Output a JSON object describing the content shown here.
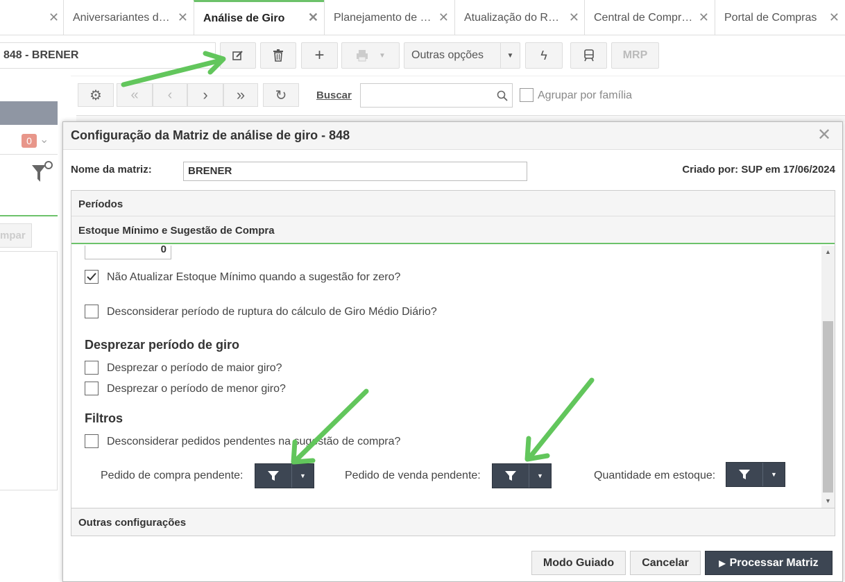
{
  "tabs": [
    {
      "label": "Aniversariantes d…"
    },
    {
      "label": "Análise de Giro"
    },
    {
      "label": "Planejamento de …"
    },
    {
      "label": "Atualização do R…"
    },
    {
      "label": "Central de Compr…"
    },
    {
      "label": "Portal de Compras"
    }
  ],
  "toolbar": {
    "selected_record": "848 - BRENER",
    "other_options": "Outras opções",
    "mrp": "MRP"
  },
  "nav": {
    "search_link": "Buscar",
    "group_by_family": "Agrupar por família"
  },
  "left_panel": {
    "badge_count": "0",
    "clear_button": "mpar"
  },
  "dialog": {
    "title": "Configuração da Matriz de análise de giro - 848",
    "matrix_name_label": "Nome da matriz:",
    "matrix_name_value": "BRENER",
    "created_by": "Criado por: SUP em 17/06/2024",
    "sections": {
      "periods": "Períodos",
      "stock": "Estoque Mínimo e Sugestão de Compra",
      "other": "Outras configurações"
    },
    "stock_input_value": "0",
    "options": {
      "no_update_min_stock": "Não Atualizar Estoque Mínimo quando a sugestão for zero?",
      "ignore_rupture": "Desconsiderar período de ruptura do cálculo de Giro Médio Diário?"
    },
    "despise_heading": "Desprezar período de giro",
    "despise": {
      "highest": "Desprezar o período de maior giro?",
      "lowest": "Desprezar o período de menor giro?"
    },
    "filters_heading": "Filtros",
    "filters": {
      "ignore_pending": "Desconsiderar pedidos pendentes na sugestão de compra?",
      "purchase_order": "Pedido de compra pendente:",
      "sales_order": "Pedido de venda pendente:",
      "stock_qty": "Quantidade em estoque:"
    },
    "buttons": {
      "guided": "Modo Guiado",
      "cancel": "Cancelar",
      "process": "Processar Matriz"
    }
  },
  "colors": {
    "accent_green": "#6cc26a",
    "dark_button": "#3d4653",
    "badge": "#e8968a"
  }
}
